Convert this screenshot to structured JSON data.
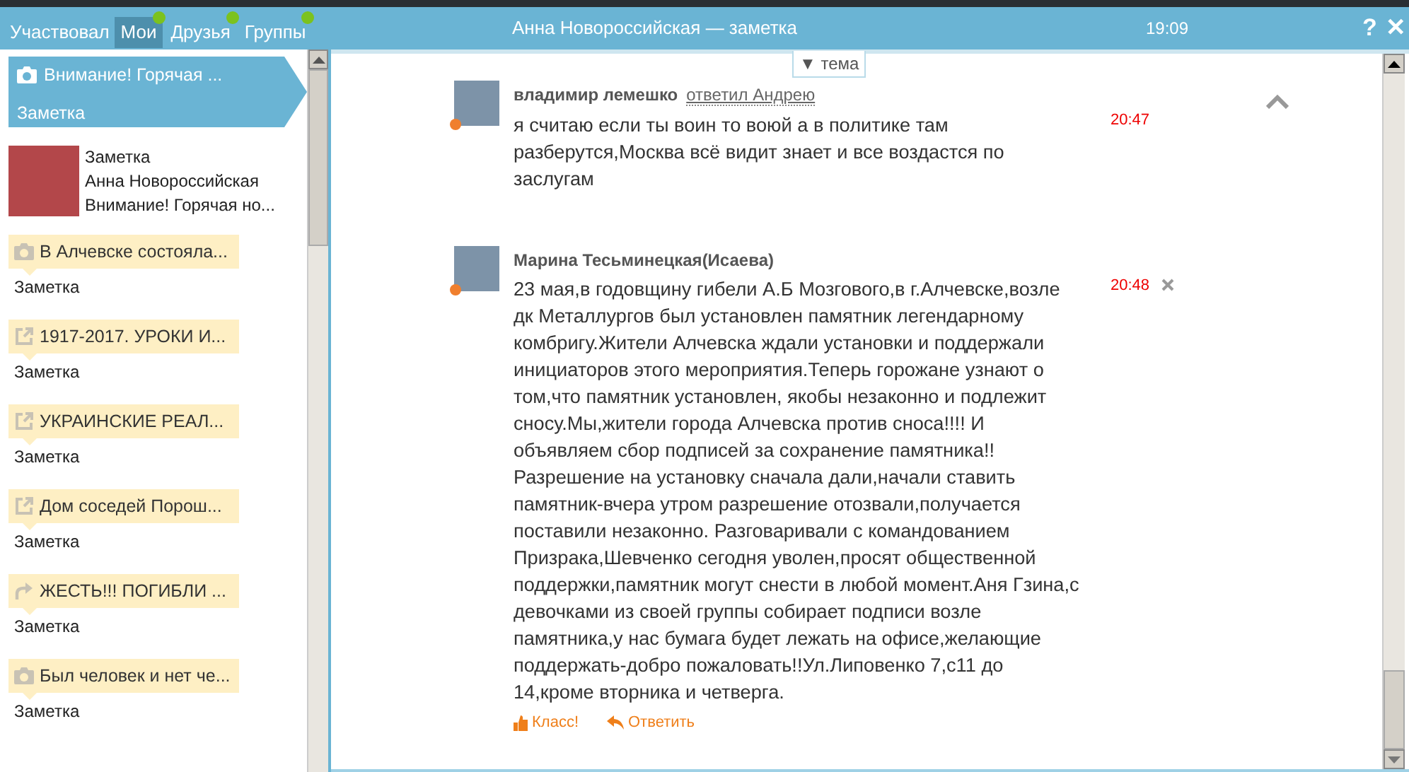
{
  "tabs": [
    {
      "label": "Участвовал",
      "selected": false,
      "has_update": false
    },
    {
      "label": "Мои",
      "selected": true,
      "has_update": true
    },
    {
      "label": "Друзья",
      "selected": false,
      "has_update": true
    },
    {
      "label": "Группы",
      "selected": false,
      "has_update": true
    }
  ],
  "window": {
    "title": "Анна Новороссийская — заметка",
    "time": "19:09",
    "help_label": "?",
    "close_label": "✕"
  },
  "sidebar": {
    "items": [
      {
        "kind": "photo",
        "title": "Внимание! Горячая ...",
        "subtitle": "Заметка",
        "selected": true
      },
      {
        "kind": "notification",
        "lines": [
          "Заметка",
          "Анна Новороссийская",
          "Внимание! Горячая но..."
        ],
        "selected": false
      },
      {
        "kind": "photo",
        "title": "В Алчевске состояла...",
        "subtitle": "Заметка",
        "selected": false
      },
      {
        "kind": "link",
        "title": "1917-2017. УРОКИ И...",
        "subtitle": "Заметка",
        "selected": false
      },
      {
        "kind": "link",
        "title": "УКРАИНСКИЕ РЕАЛ...",
        "subtitle": "Заметка",
        "selected": false
      },
      {
        "kind": "link",
        "title": "Дом соседей Порош...",
        "subtitle": "Заметка",
        "selected": false
      },
      {
        "kind": "reshare",
        "title": "ЖЕСТЬ!!! ПОГИБЛИ ...",
        "subtitle": "Заметка",
        "selected": false
      },
      {
        "kind": "photo",
        "title": "Был человек и нет че...",
        "subtitle": "Заметка",
        "selected": false
      }
    ]
  },
  "topic_toggle": "▼ тема",
  "messages": [
    {
      "author": "владимир лемешко",
      "reply_to": "ответил Андрею",
      "online": true,
      "time": "20:47",
      "deletable": false,
      "collapse": true,
      "text": "я считаю если ты воин то воюй а в политике там разберутся,Москва всё видит знает и все воздастся по заслугам"
    },
    {
      "author": "Марина Тесьминецкая(Исаева)",
      "online": true,
      "time": "20:48",
      "deletable": true,
      "collapse": false,
      "text": "23 мая,в годовщину гибели А.Б Мозгового,в г.Алчевске,возле дк Металлургов был установлен памятник легендарному комбригу.Жители Алчевска ждали установки и поддержали инициаторов этого мероприятия.Теперь горожане узнают о том,что памятник установлен, якобы незаконно и подлежит сносу.Мы,жители города Алчевска против сноса!!!! И объявляем сбор подписей за сохранение памятника!! Разрешение на установку сначала дали,начали ставить памятник-вчера утром разрешение отозвали,получается поставили незаконно. Разговаривали с командованием Призрака,Шевченко сегодня уволен,просят общественной поддержки,памятник могут снести в любой момент.Аня Гзина,с девочками из своей группы собирает подписи возле памятника,у нас бумага будет лежать на офисе,желающие поддержать-добро пожаловать!!Ул.Липовенко 7,с11 до 14,кроме вторника и четверга.",
      "actions": [
        {
          "kind": "like",
          "label": "Класс!"
        },
        {
          "kind": "reply",
          "label": "Ответить"
        }
      ]
    }
  ]
}
